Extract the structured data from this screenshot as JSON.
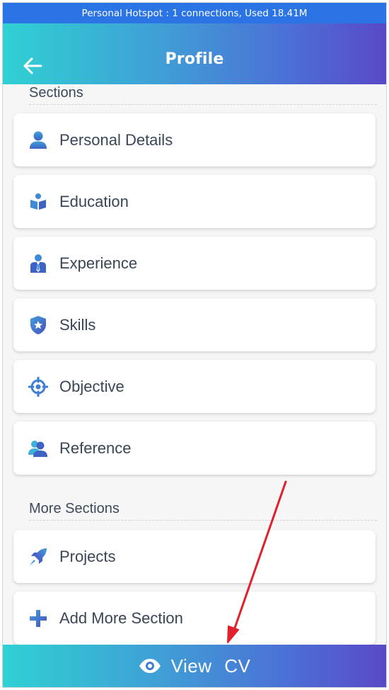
{
  "status_bar": {
    "text": "Personal Hotspot : 1 connections, Used 18.41M"
  },
  "header": {
    "title": "Profile",
    "back_icon": "arrow-left-icon"
  },
  "sections": {
    "heading": "Sections",
    "items": [
      {
        "label": "Personal Details",
        "icon": "person-icon"
      },
      {
        "label": "Education",
        "icon": "open-book-icon"
      },
      {
        "label": "Experience",
        "icon": "businessman-icon"
      },
      {
        "label": "Skills",
        "icon": "shield-star-icon"
      },
      {
        "label": "Objective",
        "icon": "target-icon"
      },
      {
        "label": "Reference",
        "icon": "users-icon"
      }
    ]
  },
  "more_sections": {
    "heading": "More Sections",
    "items": [
      {
        "label": "Projects",
        "icon": "rocket-icon"
      },
      {
        "label": "Add More Section",
        "icon": "plus-icon"
      }
    ]
  },
  "bottom_button": {
    "label": "View  CV",
    "icon": "eye-icon"
  },
  "colors": {
    "gradient_start": "#2fd1d3",
    "gradient_end": "#5949c6",
    "status_bar": "#2b74e6",
    "icon_blue": "#3f86d6",
    "annotation_arrow": "#e0202a"
  }
}
